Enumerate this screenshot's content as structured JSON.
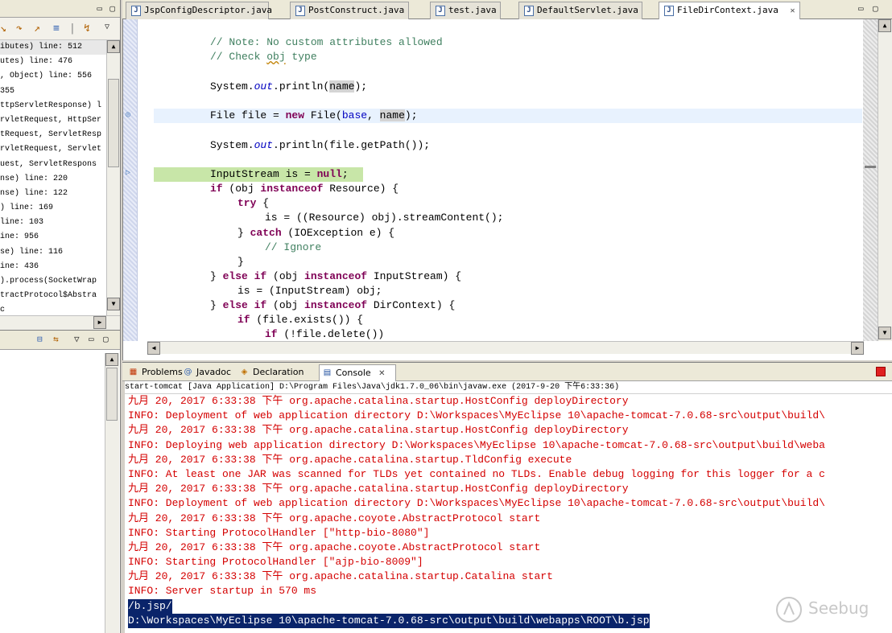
{
  "left_panel": {
    "stack_rows": [
      "ibutes) line: 512",
      "utes) line: 476",
      ", Object) line: 556",
      " 355",
      "ttpServletResponse) l",
      "rvletRequest, HttpSer",
      "tRequest, ServletResp",
      "rvletRequest, Servlet",
      "uest, ServletRespons",
      "nse) line: 220",
      "nse) line: 122",
      ") line: 169",
      " line: 103",
      "ine: 956",
      "se) line: 116",
      "ine: 436",
      ").process(SocketWrap",
      "tractProtocol$Abstra",
      "c"
    ]
  },
  "tabs": [
    {
      "label": "JspConfigDescriptor.java",
      "active": false
    },
    {
      "label": "PostConstruct.java",
      "active": false
    },
    {
      "label": "test.java",
      "active": false
    },
    {
      "label": "DefaultServlet.java",
      "active": false
    },
    {
      "label": "FileDirContext.java",
      "active": true
    }
  ],
  "code": {
    "line1": "// Note: No custom attributes allowed",
    "line2a": "// Check ",
    "line2b": "obj",
    "line2c": " type",
    "line3a": "System.",
    "line3b": "out",
    "line3c": ".println(",
    "line3d": "name",
    "line3e": ");",
    "line4a": "File file = ",
    "line4b": "new",
    "line4c": " File(",
    "line4d": "base",
    "line4e": ", ",
    "line4f": "name",
    "line4g": ");",
    "line5a": "System.",
    "line5b": "out",
    "line5c": ".println(file.getPath());",
    "line6a": "InputStream is = ",
    "line6b": "null",
    "line6c": ";",
    "line7a": "if",
    "line7b": " (obj ",
    "line7c": "instanceof",
    "line7d": " Resource) {",
    "line8a": "try",
    "line8b": " {",
    "line9": "is = ((Resource) obj).streamContent();",
    "line10a": "} ",
    "line10b": "catch",
    "line10c": " (IOException e) {",
    "line11": "// Ignore",
    "line12": "}",
    "line13a": "} ",
    "line13b": "else if",
    "line13c": " (obj ",
    "line13d": "instanceof",
    "line13e": " InputStream) {",
    "line14": "is = (InputStream) obj;",
    "line15a": "} ",
    "line15b": "else if",
    "line15c": " (obj ",
    "line15d": "instanceof",
    "line15e": " DirContext) {",
    "line16a": "if",
    "line16b": " (file.exists()) {",
    "line17a": "if",
    "line17b": " (!file.delete())"
  },
  "console_tabs": [
    {
      "label": "Problems",
      "icon": "problems-icon"
    },
    {
      "label": "Javadoc",
      "icon": "javadoc-icon"
    },
    {
      "label": "Declaration",
      "icon": "declaration-icon"
    },
    {
      "label": "Console",
      "icon": "console-icon"
    }
  ],
  "console_header": "start-tomcat [Java Application] D:\\Program Files\\Java\\jdk1.7.0_06\\bin\\javaw.exe (2017-9-20 下午6:33:36)",
  "console_lines": [
    "九月 20, 2017 6:33:38 下午 org.apache.catalina.startup.HostConfig deployDirectory",
    "INFO: Deployment of web application directory D:\\Workspaces\\MyEclipse 10\\apache-tomcat-7.0.68-src\\output\\build\\",
    "九月 20, 2017 6:33:38 下午 org.apache.catalina.startup.HostConfig deployDirectory",
    "INFO: Deploying web application directory D:\\Workspaces\\MyEclipse 10\\apache-tomcat-7.0.68-src\\output\\build\\weba",
    "九月 20, 2017 6:33:38 下午 org.apache.catalina.startup.TldConfig execute",
    "INFO: At least one JAR was scanned for TLDs yet contained no TLDs. Enable debug logging for this logger for a c",
    "九月 20, 2017 6:33:38 下午 org.apache.catalina.startup.HostConfig deployDirectory",
    "INFO: Deployment of web application directory D:\\Workspaces\\MyEclipse 10\\apache-tomcat-7.0.68-src\\output\\build\\",
    "九月 20, 2017 6:33:38 下午 org.apache.coyote.AbstractProtocol start",
    "INFO: Starting ProtocolHandler [\"http-bio-8080\"]",
    "九月 20, 2017 6:33:38 下午 org.apache.coyote.AbstractProtocol start",
    "INFO: Starting ProtocolHandler [\"ajp-bio-8009\"]",
    "九月 20, 2017 6:33:38 下午 org.apache.catalina.startup.Catalina start",
    "INFO: Server startup in 570 ms"
  ],
  "console_selected": [
    "/b.jsp/",
    "D:\\Workspaces\\MyEclipse 10\\apache-tomcat-7.0.68-src\\output\\build\\webapps\\ROOT\\b.jsp"
  ],
  "watermark": "Seebug",
  "colors": {
    "keyword": "#7f0055",
    "comment": "#3f7f5f",
    "field": "#0000c0",
    "console_error": "#d40000",
    "selection": "#0a246a"
  }
}
